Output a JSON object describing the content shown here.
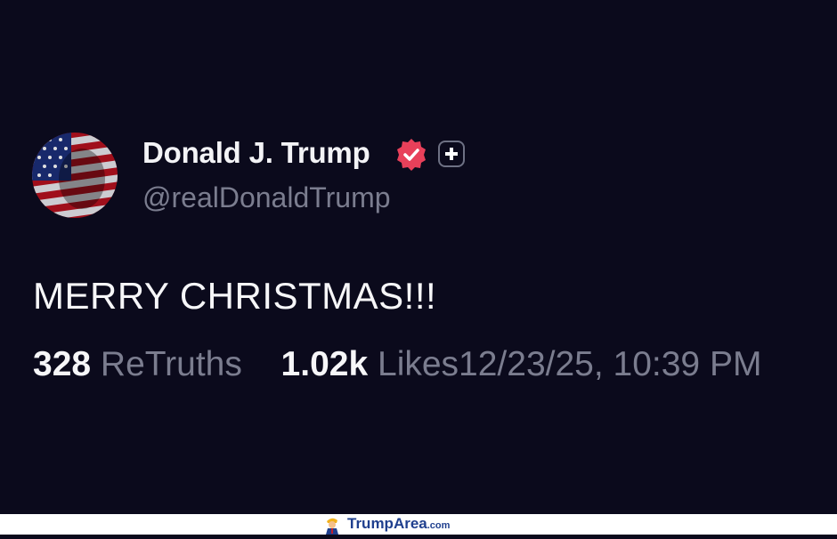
{
  "post": {
    "display_name": "Donald J. Trump",
    "handle": "@realDonaldTrump",
    "text": "MERRY CHRISTMAS!!!",
    "retruths_count": "328",
    "retruths_label": "ReTruths",
    "likes_count": "1.02k",
    "likes_label": "Likes",
    "timestamp": "12/23/25, 10:39 PM"
  },
  "icons": {
    "avatar": "avatar-flag-portrait",
    "verified": "verified-badge-icon",
    "plus": "plus-icon"
  },
  "colors": {
    "background": "#0b0a1c",
    "text_primary": "#f6f6f8",
    "text_secondary": "#7b7d8f",
    "verified": "#e8405a"
  },
  "footer": {
    "brand": "TrumpArea",
    "suffix": ".com"
  }
}
